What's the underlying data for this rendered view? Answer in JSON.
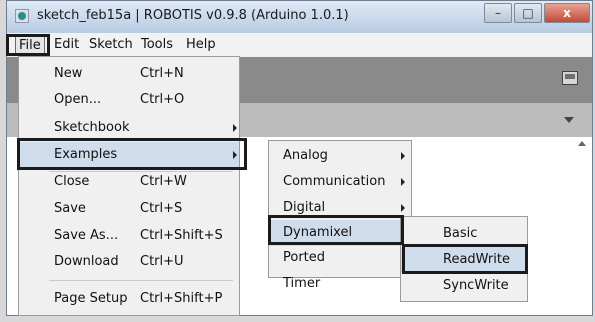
{
  "window": {
    "title": "sketch_feb15a | ROBOTIS v0.9.8 (Arduino 1.0.1)",
    "minimize": "–",
    "maximize": "□",
    "close": "x"
  },
  "menubar": [
    "File",
    "Edit",
    "Sketch",
    "Tools",
    "Help"
  ],
  "file_menu": [
    {
      "label": "New",
      "shortcut": "Ctrl+N"
    },
    {
      "label": "Open...",
      "shortcut": "Ctrl+O"
    },
    {
      "label": "Sketchbook",
      "shortcut": ""
    },
    {
      "label": "Examples",
      "shortcut": ""
    },
    {
      "label": "Close",
      "shortcut": "Ctrl+W"
    },
    {
      "label": "Save",
      "shortcut": "Ctrl+S"
    },
    {
      "label": "Save As...",
      "shortcut": "Ctrl+Shift+S"
    },
    {
      "label": "Download",
      "shortcut": "Ctrl+U"
    },
    {
      "label": "Page Setup",
      "shortcut": "Ctrl+Shift+P"
    }
  ],
  "examples_menu": [
    "Analog",
    "Communication",
    "Digital",
    "Dynamixel",
    "Ported",
    "Timer"
  ],
  "dynamixel_menu": [
    "Basic",
    "ReadWrite",
    "SyncWrite"
  ],
  "icons": {
    "app": "app-icon",
    "serial_monitor": "serial-monitor-icon",
    "tab_menu": "chevron-down-icon",
    "submenu": "chevron-right-icon"
  }
}
